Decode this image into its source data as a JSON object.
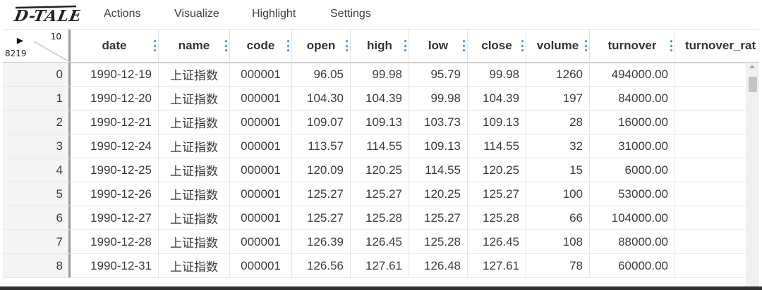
{
  "app": {
    "logo_text": "D-TALE"
  },
  "menu": [
    {
      "label": "Actions"
    },
    {
      "label": "Visualize"
    },
    {
      "label": "Highlight"
    },
    {
      "label": "Settings"
    }
  ],
  "grid": {
    "corner": {
      "column_count": "10",
      "row_count": "8219"
    },
    "columns": [
      {
        "key": "date",
        "label": "date"
      },
      {
        "key": "name",
        "label": "name"
      },
      {
        "key": "code",
        "label": "code"
      },
      {
        "key": "open",
        "label": "open"
      },
      {
        "key": "high",
        "label": "high"
      },
      {
        "key": "low",
        "label": "low"
      },
      {
        "key": "close",
        "label": "close"
      },
      {
        "key": "volume",
        "label": "volume"
      },
      {
        "key": "turnover",
        "label": "turnover"
      },
      {
        "key": "turnover_rate",
        "label": "turnover_rat"
      }
    ],
    "rows": [
      {
        "idx": "0",
        "date": "1990-12-19",
        "name": "上证指数",
        "code": "000001",
        "open": "96.05",
        "high": "99.98",
        "low": "95.79",
        "close": "99.98",
        "volume": "1260",
        "turnover": "494000.00",
        "turnover_rate": "("
      },
      {
        "idx": "1",
        "date": "1990-12-20",
        "name": "上证指数",
        "code": "000001",
        "open": "104.30",
        "high": "104.39",
        "low": "99.98",
        "close": "104.39",
        "volume": "197",
        "turnover": "84000.00",
        "turnover_rate": "("
      },
      {
        "idx": "2",
        "date": "1990-12-21",
        "name": "上证指数",
        "code": "000001",
        "open": "109.07",
        "high": "109.13",
        "low": "103.73",
        "close": "109.13",
        "volume": "28",
        "turnover": "16000.00",
        "turnover_rate": "("
      },
      {
        "idx": "3",
        "date": "1990-12-24",
        "name": "上证指数",
        "code": "000001",
        "open": "113.57",
        "high": "114.55",
        "low": "109.13",
        "close": "114.55",
        "volume": "32",
        "turnover": "31000.00",
        "turnover_rate": "("
      },
      {
        "idx": "4",
        "date": "1990-12-25",
        "name": "上证指数",
        "code": "000001",
        "open": "120.09",
        "high": "120.25",
        "low": "114.55",
        "close": "120.25",
        "volume": "15",
        "turnover": "6000.00",
        "turnover_rate": "("
      },
      {
        "idx": "5",
        "date": "1990-12-26",
        "name": "上证指数",
        "code": "000001",
        "open": "125.27",
        "high": "125.27",
        "low": "120.25",
        "close": "125.27",
        "volume": "100",
        "turnover": "53000.00",
        "turnover_rate": "("
      },
      {
        "idx": "6",
        "date": "1990-12-27",
        "name": "上证指数",
        "code": "000001",
        "open": "125.27",
        "high": "125.28",
        "low": "125.27",
        "close": "125.28",
        "volume": "66",
        "turnover": "104000.00",
        "turnover_rate": "("
      },
      {
        "idx": "7",
        "date": "1990-12-28",
        "name": "上证指数",
        "code": "000001",
        "open": "126.39",
        "high": "126.45",
        "low": "125.28",
        "close": "126.45",
        "volume": "108",
        "turnover": "88000.00",
        "turnover_rate": "("
      },
      {
        "idx": "8",
        "date": "1990-12-31",
        "name": "上证指数",
        "code": "000001",
        "open": "126.56",
        "high": "127.61",
        "low": "126.48",
        "close": "127.61",
        "volume": "78",
        "turnover": "60000.00",
        "turnover_rate": "("
      }
    ]
  },
  "colors": {
    "accent": "#2f8fd8",
    "divider": "#9a9a9a",
    "row_border": "#e6e6e6"
  }
}
